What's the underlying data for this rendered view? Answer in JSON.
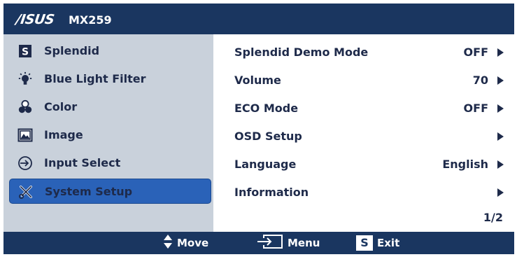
{
  "header": {
    "brand": "/ISUS",
    "model": "MX259"
  },
  "sidebar": {
    "items": [
      {
        "label": "Splendid",
        "icon": "splendid-s-icon"
      },
      {
        "label": "Blue Light Filter",
        "icon": "light-bulb-icon"
      },
      {
        "label": "Color",
        "icon": "color-rgb-icon"
      },
      {
        "label": "Image",
        "icon": "image-icon"
      },
      {
        "label": "Input Select",
        "icon": "input-arrow-icon"
      },
      {
        "label": "System Setup",
        "icon": "tools-icon",
        "selected": true
      }
    ]
  },
  "settings": [
    {
      "label": "Splendid Demo Mode",
      "value": "OFF"
    },
    {
      "label": "Volume",
      "value": "70"
    },
    {
      "label": "ECO Mode",
      "value": "OFF"
    },
    {
      "label": "OSD Setup",
      "value": ""
    },
    {
      "label": "Language",
      "value": "English"
    },
    {
      "label": "Information",
      "value": ""
    }
  ],
  "page": "1/2",
  "footer": {
    "move": "Move",
    "menu": "Menu",
    "exit": "Exit",
    "exit_key": "S"
  },
  "colors": {
    "header_bg": "#1a3660",
    "sidebar_bg": "#c9d1db",
    "selected_bg": "#2a62b8",
    "text": "#1e2a4a"
  }
}
